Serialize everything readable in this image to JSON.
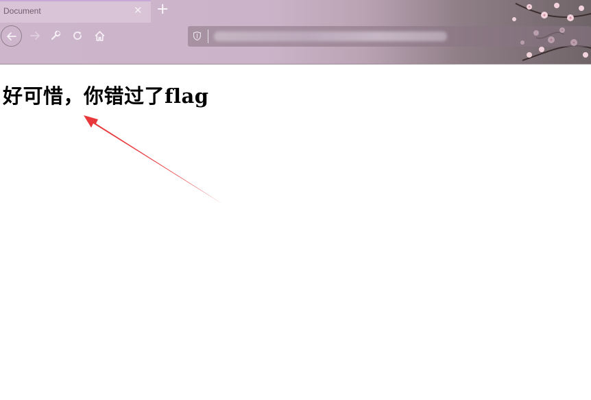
{
  "browser": {
    "tab": {
      "title": "Document",
      "close_icon": "close-icon"
    },
    "new_tab_icon": "plus-icon",
    "nav": {
      "back_icon": "back-arrow-icon",
      "forward_icon": "forward-arrow-icon",
      "tools_icon": "wrench-icon",
      "reload_icon": "reload-icon",
      "home_icon": "home-icon"
    },
    "urlbar": {
      "security_icon": "shield-icon",
      "url_visible": false
    }
  },
  "page": {
    "heading": "好可惜，你错过了flag",
    "annotation_arrow_color": "#e8383b"
  }
}
